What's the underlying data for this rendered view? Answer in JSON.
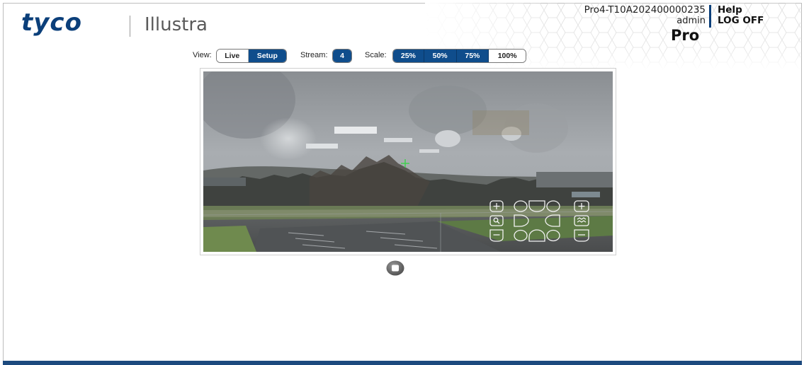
{
  "header": {
    "brand": "tyco",
    "product": "Illustra",
    "device_id": "Pro4-T10A202400000235",
    "user": "admin",
    "help_label": "Help",
    "logoff_label": "LOG OFF",
    "model_label": "Pro"
  },
  "toolbar": {
    "view_label": "View:",
    "view_options": [
      "Live",
      "Setup"
    ],
    "view_selected": "Setup",
    "stream_label": "Stream:",
    "stream_value": "4",
    "scale_label": "Scale:",
    "scale_options": [
      "25%",
      "50%",
      "75%",
      "100%"
    ]
  },
  "ptz_icons": [
    "zoom-in-icon",
    "tilt-up-left-icon",
    "tilt-up-icon",
    "tilt-up-right-icon",
    "focus-plus-icon",
    "magnify-icon",
    "pan-right-icon",
    "pan-left-icon",
    "focus-auto-icon",
    "zoom-out-icon",
    "tilt-down-left-icon",
    "tilt-down-icon",
    "tilt-down-right-icon",
    "focus-minus-icon"
  ],
  "controls": {
    "stop_icon": "stop-icon"
  },
  "colors": {
    "brand_blue": "#0b3f7a",
    "button_blue": "#0f4d8c",
    "footer_bar": "#1c4a7e"
  }
}
